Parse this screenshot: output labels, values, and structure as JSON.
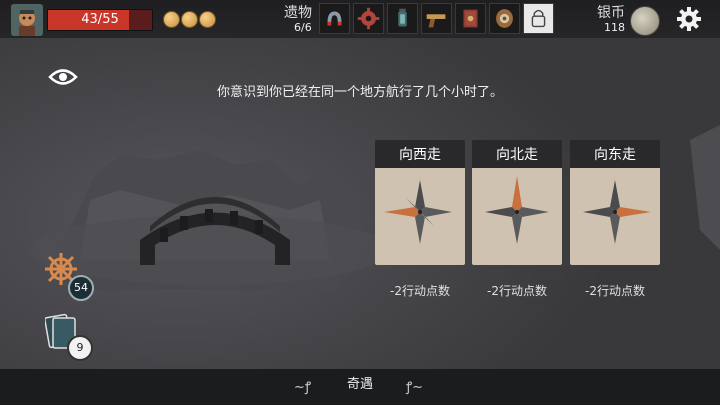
{
  "hud": {
    "hp_text": "43/55",
    "hp_fraction": 0.78,
    "coin_count": 3,
    "relics_label": "遗物",
    "relics_count": "6/6",
    "relic_icons": [
      "magnet-icon",
      "cog-icon",
      "lantern-icon",
      "pistol-icon",
      "book-icon",
      "barrel-icon",
      "padlock-icon"
    ],
    "silver_label": "银币",
    "silver_count": "118"
  },
  "event": {
    "text": "你意识到你已经在同一个地方航行了几个小时了。"
  },
  "choices": [
    {
      "title": "向西走",
      "cost": "-2行动点数",
      "highlight": "west"
    },
    {
      "title": "向北走",
      "cost": "-2行动点数",
      "highlight": "north"
    },
    {
      "title": "向东走",
      "cost": "-2行动点数",
      "highlight": "east"
    }
  ],
  "side": {
    "helm_badge": "54",
    "deck_badge": "9"
  },
  "footer": {
    "title": "奇遇"
  },
  "colors": {
    "accent": "#c8362a",
    "compass_highlight": "#c9703f"
  }
}
